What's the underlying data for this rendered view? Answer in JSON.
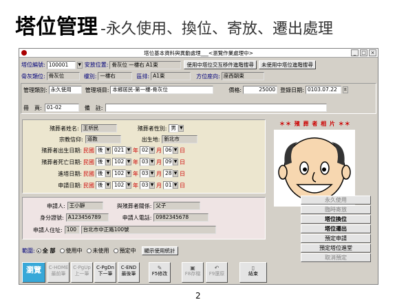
{
  "slide": {
    "title_main": "塔位管理",
    "title_sub": "-永久使用、換位、寄放、遷出處理",
    "page_number": "2"
  },
  "window": {
    "title": "塔位基本資料與異動處理___<瀏覽作業處理中>",
    "min": "_",
    "max": "□",
    "close": "×"
  },
  "top": {
    "tower_no_label": "塔位編號:",
    "tower_no": "100001",
    "location_label": "安放位置:",
    "location": "骨灰位 一樓右 A1東",
    "btn_swap": "使用中塔位交互移件進階搜尋",
    "btn_unused": "未使用中塔位進階搜尋",
    "type_label": "骨灰類位:",
    "type": "骨灰位",
    "floor_label": "樓別:",
    "floor": "一樓右",
    "zone_label": "區排:",
    "zone": "A1東",
    "direction_label": "方位座向:",
    "direction": "座西朝東"
  },
  "mgmt": {
    "category_label": "管理類別:",
    "category": "永久使用",
    "item_label": "管理項目:",
    "item": "本鄉居民-第一樓-骨灰位",
    "price_label": "價格:",
    "price": "25000",
    "reg_date_label": "登錄日期:",
    "reg_date": "0103.07.22",
    "book_label": "冊　頁:",
    "book": "01-02",
    "note_label": "備　註:",
    "note": ""
  },
  "deceased": {
    "name_label": "殯葬者姓名:",
    "name": "王祈民",
    "gender_label": "殯葬者性別:",
    "gender": "男",
    "religion_label": "宗教信仰:",
    "religion": "道教",
    "birthplace_label": "出生地:",
    "birthplace": "新北市",
    "birth_label": "殯葬者出生日期:",
    "birth": {
      "era": "民國",
      "pre": "後",
      "y": "021",
      "m": "02",
      "d": "06"
    },
    "death_label": "殯葬者死亡日期:",
    "death": {
      "era": "民國",
      "pre": "後",
      "y": "102",
      "m": "03",
      "d": "09"
    },
    "enter_label": "進塔日期:",
    "enter": {
      "era": "民國",
      "pre": "後",
      "y": "102",
      "m": "03",
      "d": "28"
    },
    "apply_label": "申請日期:",
    "apply": {
      "era": "民國",
      "pre": "後",
      "y": "102",
      "m": "03",
      "d": "01"
    },
    "unit_y": "年",
    "unit_m": "月",
    "unit_d": "日"
  },
  "photo": {
    "title": "＊＊ 殯 葬 者 相 片 ＊＊"
  },
  "applicant": {
    "name_label": "申請人:",
    "name": "王小靜",
    "relation_label": "與殯葬者關係:",
    "relation": "父子",
    "id_label": "身分證號:",
    "id": "A123456789",
    "phone_label": "申請人電話:",
    "phone": "0982345678",
    "address_label": "申請人住址:",
    "zip": "100",
    "address": "台北市中正路100號"
  },
  "right_buttons": [
    "永久使用",
    "臨時寄放",
    "塔位換位",
    "塔位遷出",
    "預定申請",
    "預定塔位進堂",
    "取消預定"
  ],
  "filter": {
    "label": "範圍:",
    "all": "全 部",
    "in_use": "使用中",
    "unused": "未使用",
    "reserved": "預定中",
    "stats_btn": "顯示使用統計"
  },
  "toolbar": {
    "browse": "瀏覽",
    "first_key": "C-HOME",
    "first": "最前筆",
    "prev_key": "C-PgUp",
    "prev": "上一筆",
    "next_key": "C-PgDn",
    "next": "下一筆",
    "last_key": "C-END",
    "last": "最後筆",
    "edit": "F5修改",
    "save": "F8存檔",
    "undo": "F9還原",
    "exit": "結束"
  },
  "colors": {
    "window_bg": "#d4d0c8",
    "tan_panel": "#ece6cf",
    "pink_panel": "#efe4e4",
    "browse_btn": "#38a8d8",
    "accent_red": "#cc0000"
  }
}
